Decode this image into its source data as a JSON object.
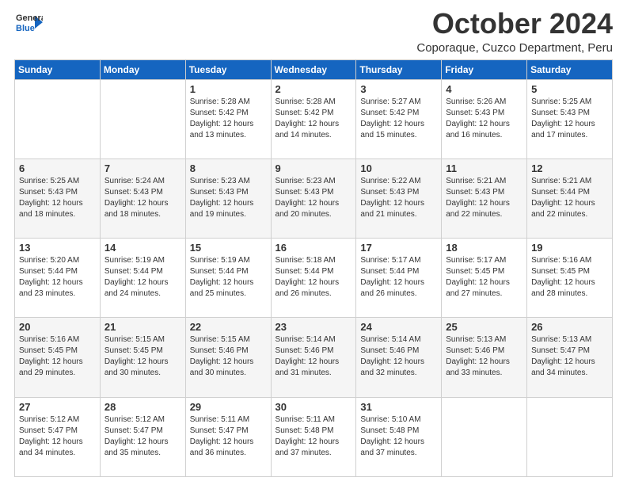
{
  "logo": {
    "general": "General",
    "blue": "Blue"
  },
  "header": {
    "month": "October 2024",
    "location": "Coporaque, Cuzco Department, Peru"
  },
  "days_of_week": [
    "Sunday",
    "Monday",
    "Tuesday",
    "Wednesday",
    "Thursday",
    "Friday",
    "Saturday"
  ],
  "weeks": [
    [
      {
        "day": "",
        "info": ""
      },
      {
        "day": "",
        "info": ""
      },
      {
        "day": "1",
        "info": "Sunrise: 5:28 AM\nSunset: 5:42 PM\nDaylight: 12 hours and 13 minutes."
      },
      {
        "day": "2",
        "info": "Sunrise: 5:28 AM\nSunset: 5:42 PM\nDaylight: 12 hours and 14 minutes."
      },
      {
        "day": "3",
        "info": "Sunrise: 5:27 AM\nSunset: 5:42 PM\nDaylight: 12 hours and 15 minutes."
      },
      {
        "day": "4",
        "info": "Sunrise: 5:26 AM\nSunset: 5:43 PM\nDaylight: 12 hours and 16 minutes."
      },
      {
        "day": "5",
        "info": "Sunrise: 5:25 AM\nSunset: 5:43 PM\nDaylight: 12 hours and 17 minutes."
      }
    ],
    [
      {
        "day": "6",
        "info": "Sunrise: 5:25 AM\nSunset: 5:43 PM\nDaylight: 12 hours and 18 minutes."
      },
      {
        "day": "7",
        "info": "Sunrise: 5:24 AM\nSunset: 5:43 PM\nDaylight: 12 hours and 18 minutes."
      },
      {
        "day": "8",
        "info": "Sunrise: 5:23 AM\nSunset: 5:43 PM\nDaylight: 12 hours and 19 minutes."
      },
      {
        "day": "9",
        "info": "Sunrise: 5:23 AM\nSunset: 5:43 PM\nDaylight: 12 hours and 20 minutes."
      },
      {
        "day": "10",
        "info": "Sunrise: 5:22 AM\nSunset: 5:43 PM\nDaylight: 12 hours and 21 minutes."
      },
      {
        "day": "11",
        "info": "Sunrise: 5:21 AM\nSunset: 5:43 PM\nDaylight: 12 hours and 22 minutes."
      },
      {
        "day": "12",
        "info": "Sunrise: 5:21 AM\nSunset: 5:44 PM\nDaylight: 12 hours and 22 minutes."
      }
    ],
    [
      {
        "day": "13",
        "info": "Sunrise: 5:20 AM\nSunset: 5:44 PM\nDaylight: 12 hours and 23 minutes."
      },
      {
        "day": "14",
        "info": "Sunrise: 5:19 AM\nSunset: 5:44 PM\nDaylight: 12 hours and 24 minutes."
      },
      {
        "day": "15",
        "info": "Sunrise: 5:19 AM\nSunset: 5:44 PM\nDaylight: 12 hours and 25 minutes."
      },
      {
        "day": "16",
        "info": "Sunrise: 5:18 AM\nSunset: 5:44 PM\nDaylight: 12 hours and 26 minutes."
      },
      {
        "day": "17",
        "info": "Sunrise: 5:17 AM\nSunset: 5:44 PM\nDaylight: 12 hours and 26 minutes."
      },
      {
        "day": "18",
        "info": "Sunrise: 5:17 AM\nSunset: 5:45 PM\nDaylight: 12 hours and 27 minutes."
      },
      {
        "day": "19",
        "info": "Sunrise: 5:16 AM\nSunset: 5:45 PM\nDaylight: 12 hours and 28 minutes."
      }
    ],
    [
      {
        "day": "20",
        "info": "Sunrise: 5:16 AM\nSunset: 5:45 PM\nDaylight: 12 hours and 29 minutes."
      },
      {
        "day": "21",
        "info": "Sunrise: 5:15 AM\nSunset: 5:45 PM\nDaylight: 12 hours and 30 minutes."
      },
      {
        "day": "22",
        "info": "Sunrise: 5:15 AM\nSunset: 5:46 PM\nDaylight: 12 hours and 30 minutes."
      },
      {
        "day": "23",
        "info": "Sunrise: 5:14 AM\nSunset: 5:46 PM\nDaylight: 12 hours and 31 minutes."
      },
      {
        "day": "24",
        "info": "Sunrise: 5:14 AM\nSunset: 5:46 PM\nDaylight: 12 hours and 32 minutes."
      },
      {
        "day": "25",
        "info": "Sunrise: 5:13 AM\nSunset: 5:46 PM\nDaylight: 12 hours and 33 minutes."
      },
      {
        "day": "26",
        "info": "Sunrise: 5:13 AM\nSunset: 5:47 PM\nDaylight: 12 hours and 34 minutes."
      }
    ],
    [
      {
        "day": "27",
        "info": "Sunrise: 5:12 AM\nSunset: 5:47 PM\nDaylight: 12 hours and 34 minutes."
      },
      {
        "day": "28",
        "info": "Sunrise: 5:12 AM\nSunset: 5:47 PM\nDaylight: 12 hours and 35 minutes."
      },
      {
        "day": "29",
        "info": "Sunrise: 5:11 AM\nSunset: 5:47 PM\nDaylight: 12 hours and 36 minutes."
      },
      {
        "day": "30",
        "info": "Sunrise: 5:11 AM\nSunset: 5:48 PM\nDaylight: 12 hours and 37 minutes."
      },
      {
        "day": "31",
        "info": "Sunrise: 5:10 AM\nSunset: 5:48 PM\nDaylight: 12 hours and 37 minutes."
      },
      {
        "day": "",
        "info": ""
      },
      {
        "day": "",
        "info": ""
      }
    ]
  ]
}
